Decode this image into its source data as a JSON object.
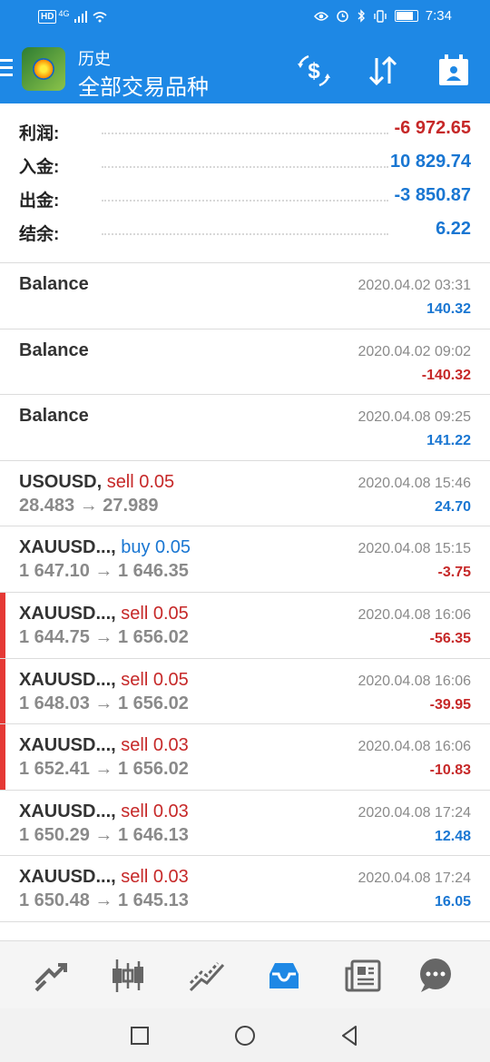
{
  "status_bar": {
    "network_badge": "HD",
    "network_type": "4G",
    "time": "7:34",
    "icons": [
      "eye-icon",
      "alarm-icon",
      "bluetooth-icon",
      "vibrate-icon",
      "battery-icon"
    ]
  },
  "appbar": {
    "subtitle": "历史",
    "title": "全部交易品种",
    "actions": [
      "currency-icon",
      "sort-icon",
      "calendar-icon"
    ]
  },
  "summary": [
    {
      "label": "利润:",
      "value": "-6 972.65",
      "color": "#c62828"
    },
    {
      "label": "入金:",
      "value": "10 829.74",
      "color": "#1976d2"
    },
    {
      "label": "出金:",
      "value": "-3 850.87",
      "color": "#1976d2"
    },
    {
      "label": "结余:",
      "value": "6.22",
      "color": "#1976d2"
    }
  ],
  "deals": [
    {
      "symbol": "Balance",
      "side": "",
      "prices": "",
      "time": "2020.04.02 03:31",
      "profit": "140.32",
      "profit_color": "blue",
      "marked": false
    },
    {
      "symbol": "Balance",
      "side": "",
      "prices": "",
      "time": "2020.04.02 09:02",
      "profit": "-140.32",
      "profit_color": "red",
      "marked": false
    },
    {
      "symbol": "Balance",
      "side": "",
      "prices": "",
      "time": "2020.04.08 09:25",
      "profit": "141.22",
      "profit_color": "blue",
      "marked": false
    },
    {
      "symbol": "USOUSD, ",
      "side": "sell 0.05",
      "side_type": "sell",
      "prices": "28.483 → 27.989",
      "time": "2020.04.08 15:46",
      "profit": "24.70",
      "profit_color": "blue",
      "marked": false
    },
    {
      "symbol": "XAUUSD..., ",
      "side": "buy 0.05",
      "side_type": "buy",
      "prices": "1 647.10 → 1 646.35",
      "time": "2020.04.08 15:15",
      "profit": "-3.75",
      "profit_color": "red",
      "marked": false
    },
    {
      "symbol": "XAUUSD..., ",
      "side": "sell 0.05",
      "side_type": "sell",
      "prices": "1 644.75 → 1 656.02",
      "time": "2020.04.08 16:06",
      "profit": "-56.35",
      "profit_color": "red",
      "marked": true
    },
    {
      "symbol": "XAUUSD..., ",
      "side": "sell 0.05",
      "side_type": "sell",
      "prices": "1 648.03 → 1 656.02",
      "time": "2020.04.08 16:06",
      "profit": "-39.95",
      "profit_color": "red",
      "marked": true
    },
    {
      "symbol": "XAUUSD..., ",
      "side": "sell 0.03",
      "side_type": "sell",
      "prices": "1 652.41 → 1 656.02",
      "time": "2020.04.08 16:06",
      "profit": "-10.83",
      "profit_color": "red",
      "marked": true
    },
    {
      "symbol": "XAUUSD..., ",
      "side": "sell 0.03",
      "side_type": "sell",
      "prices": "1 650.29 → 1 646.13",
      "time": "2020.04.08 17:24",
      "profit": "12.48",
      "profit_color": "blue",
      "marked": false
    },
    {
      "symbol": "XAUUSD..., ",
      "side": "sell 0.03",
      "side_type": "sell",
      "prices": "1 650.48 → 1 645.13",
      "time": "2020.04.08 17:24",
      "profit": "16.05",
      "profit_color": "blue",
      "marked": false
    }
  ],
  "bottom_nav": {
    "items": [
      "quotes-icon",
      "chart-icon",
      "trade-icon",
      "history-icon",
      "news-icon",
      "chat-icon"
    ],
    "active": "history-icon",
    "active_color": "#1e88e5"
  },
  "colors": {
    "brand": "#1e88e5",
    "loss": "#c62828",
    "profit": "#1976d2",
    "marker": "#e53935"
  }
}
